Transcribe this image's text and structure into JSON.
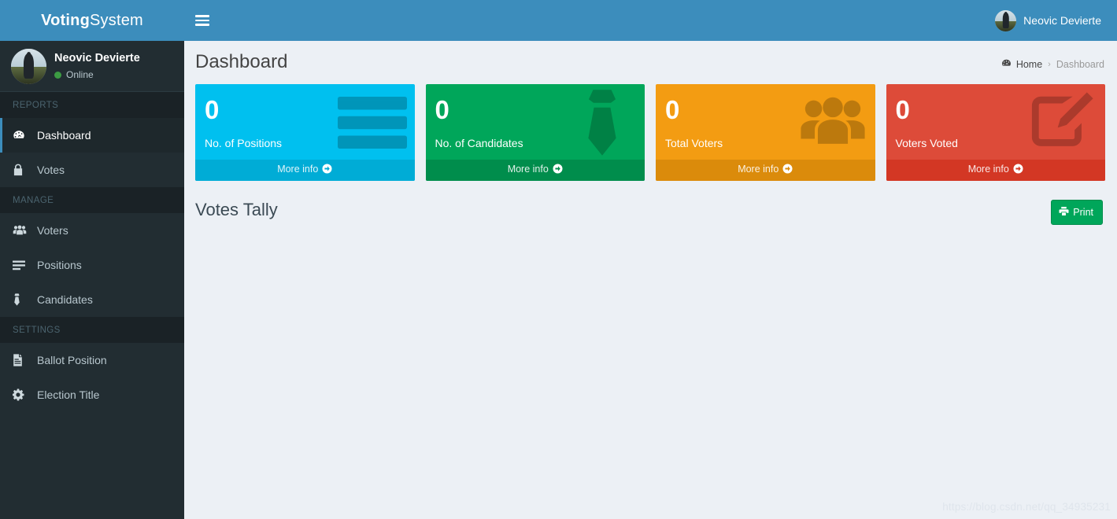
{
  "brand": {
    "bold": "Voting",
    "light": "System"
  },
  "sidebar": {
    "user": {
      "name": "Neovic Devierte",
      "status": "Online"
    },
    "sections": [
      {
        "header": "REPORTS",
        "items": [
          {
            "label": "Dashboard",
            "icon": "dashboard-icon",
            "active": true
          },
          {
            "label": "Votes",
            "icon": "lock-icon",
            "active": false
          }
        ]
      },
      {
        "header": "MANAGE",
        "items": [
          {
            "label": "Voters",
            "icon": "users-icon",
            "active": false
          },
          {
            "label": "Positions",
            "icon": "align-justify-icon",
            "active": false
          },
          {
            "label": "Candidates",
            "icon": "necktie-icon",
            "active": false
          }
        ]
      },
      {
        "header": "SETTINGS",
        "items": [
          {
            "label": "Ballot Position",
            "icon": "file-text-icon",
            "active": false
          },
          {
            "label": "Election Title",
            "icon": "gear-icon",
            "active": false
          }
        ]
      }
    ]
  },
  "topbar": {
    "user_name": "Neovic Devierte"
  },
  "content": {
    "page_title": "Dashboard",
    "breadcrumb": {
      "home": "Home",
      "separator": "›",
      "current": "Dashboard"
    },
    "boxes": [
      {
        "value": "0",
        "label": "No. of Positions",
        "footer": "More info",
        "icon": "align-justify-icon",
        "bg": "#00c0ef",
        "footer_bg": "#00acd6"
      },
      {
        "value": "0",
        "label": "No. of Candidates",
        "footer": "More info",
        "icon": "necktie-icon",
        "bg": "#00a65a",
        "footer_bg": "#008d4c"
      },
      {
        "value": "0",
        "label": "Total Voters",
        "footer": "More info",
        "icon": "users-icon",
        "bg": "#f39c12",
        "footer_bg": "#db8b0b"
      },
      {
        "value": "0",
        "label": "Voters Voted",
        "footer": "More info",
        "icon": "edit-icon",
        "bg": "#dd4b39",
        "footer_bg": "#d33724"
      }
    ],
    "tally_title": "Votes Tally",
    "print_label": "Print",
    "watermark": "https://blog.csdn.net/qq_34935231"
  }
}
